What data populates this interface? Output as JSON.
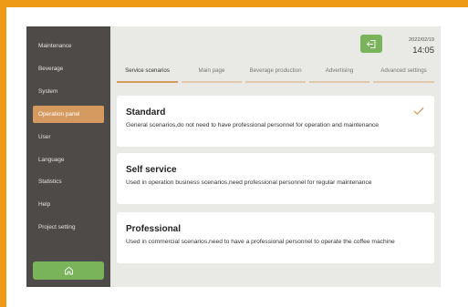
{
  "colors": {
    "accent_orange": "#d59a5f",
    "frame_orange": "#ef9a16",
    "green": "#79b35a",
    "sidebar_bg": "#4d4a47",
    "content_bg": "#e9e9e6"
  },
  "sidebar": {
    "items": [
      {
        "label": "Maintenance",
        "active": false
      },
      {
        "label": "Beverage",
        "active": false
      },
      {
        "label": "System",
        "active": false
      },
      {
        "label": "Operation panel",
        "active": true
      },
      {
        "label": "User",
        "active": false
      },
      {
        "label": "Language",
        "active": false
      },
      {
        "label": "Statistics",
        "active": false
      },
      {
        "label": "Help",
        "active": false
      },
      {
        "label": "Project setting",
        "active": false
      }
    ],
    "home_icon": "home-icon"
  },
  "header": {
    "date": "2022/02/19",
    "time": "14:05",
    "logout_icon": "logout-icon"
  },
  "tabs": [
    {
      "label": "Service scenarios",
      "active": true
    },
    {
      "label": "Main page",
      "active": false
    },
    {
      "label": "Beverage production",
      "active": false
    },
    {
      "label": "Advertising",
      "active": false
    },
    {
      "label": "Advanced settings",
      "active": false
    }
  ],
  "scenarios": [
    {
      "title": "Standard",
      "description": "General scenarios,do not need to have professional personnel for operation and maintenance",
      "selected": true
    },
    {
      "title": "Self service",
      "description": "Used in operation business scenarios,need professional personnel for regular maintenance",
      "selected": false
    },
    {
      "title": "Professional",
      "description": "Used in commercial scenarios,need to have a professional personnel to operate the coffee machine",
      "selected": false
    }
  ]
}
